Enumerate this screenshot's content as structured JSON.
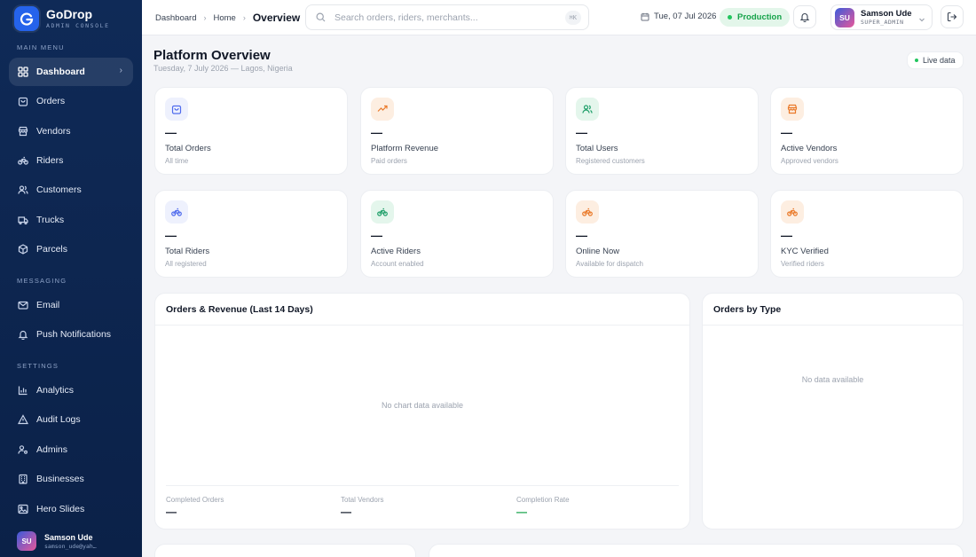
{
  "brand": {
    "name": "GoDrop",
    "subtitle": "ADMIN CONSOLE"
  },
  "sidebar": {
    "sections": {
      "main": "MAIN MENU",
      "messaging": "MESSAGING",
      "settings": "SETTINGS"
    },
    "items": [
      {
        "label": "Dashboard",
        "icon": "grid-icon"
      },
      {
        "label": "Orders",
        "icon": "bag-icon"
      },
      {
        "label": "Vendors",
        "icon": "store-icon"
      },
      {
        "label": "Riders",
        "icon": "bike-icon"
      },
      {
        "label": "Customers",
        "icon": "users-icon"
      },
      {
        "label": "Trucks",
        "icon": "truck-icon"
      },
      {
        "label": "Parcels",
        "icon": "package-icon"
      },
      {
        "label": "Email",
        "icon": "mail-icon"
      },
      {
        "label": "Push Notifications",
        "icon": "bell-icon"
      },
      {
        "label": "Analytics",
        "icon": "bar-chart-icon"
      },
      {
        "label": "Audit Logs",
        "icon": "alert-triangle-icon"
      },
      {
        "label": "Admins",
        "icon": "user-cog-icon"
      },
      {
        "label": "Businesses",
        "icon": "building-icon"
      },
      {
        "label": "Hero Slides",
        "icon": "image-icon"
      }
    ],
    "user": {
      "initials": "SU",
      "name": "Samson Ude",
      "email": "samson_ude@yah…"
    }
  },
  "topbar": {
    "breadcrumb": {
      "root": "Dashboard",
      "middle": "Home",
      "current": "Overview"
    },
    "search": {
      "placeholder": "Search orders, riders, merchants...",
      "shortcut": "⌘K"
    },
    "date": "Tue, 07 Jul 2026",
    "environment": "Production",
    "user": {
      "initials": "SU",
      "name": "Samson Ude",
      "role": "SUPER_ADMIN"
    }
  },
  "page": {
    "title": "Platform Overview",
    "subtitle": "Tuesday, 7 July 2026 — Lagos, Nigeria",
    "live_label": "Live data"
  },
  "stats": [
    {
      "value": "—",
      "label": "Total Orders",
      "sub": "All time",
      "icon": "bag-icon",
      "color": "#4f6bed",
      "bg": "#eef1fd"
    },
    {
      "value": "—",
      "label": "Platform Revenue",
      "sub": "Paid orders",
      "icon": "trending-up-icon",
      "color": "#ea7a2a",
      "bg": "#fdeee1"
    },
    {
      "value": "—",
      "label": "Total Users",
      "sub": "Registered customers",
      "icon": "users-icon",
      "color": "#22a06b",
      "bg": "#e4f6ec"
    },
    {
      "value": "—",
      "label": "Active Vendors",
      "sub": "Approved vendors",
      "icon": "store-icon",
      "color": "#ea7a2a",
      "bg": "#fdeee1"
    },
    {
      "value": "—",
      "label": "Total Riders",
      "sub": "All registered",
      "icon": "bike-icon",
      "color": "#4f6bed",
      "bg": "#eef1fd"
    },
    {
      "value": "—",
      "label": "Active Riders",
      "sub": "Account enabled",
      "icon": "bike-icon",
      "color": "#22a06b",
      "bg": "#e4f6ec"
    },
    {
      "value": "—",
      "label": "Online Now",
      "sub": "Available for dispatch",
      "icon": "bike-icon",
      "color": "#ea7a2a",
      "bg": "#fdeee1"
    },
    {
      "value": "—",
      "label": "KYC Verified",
      "sub": "Verified riders",
      "icon": "bike-icon",
      "color": "#ea7a2a",
      "bg": "#fdeee1"
    }
  ],
  "orders_revenue": {
    "title": "Orders & Revenue (Last 14 Days)",
    "empty": "No chart data available",
    "footer": [
      {
        "label": "Completed Orders",
        "value": "—"
      },
      {
        "label": "Total Vendors",
        "value": "—"
      },
      {
        "label": "Completion Rate",
        "value": "—"
      }
    ]
  },
  "orders_by_type": {
    "title": "Orders by Type",
    "empty": "No data available"
  }
}
